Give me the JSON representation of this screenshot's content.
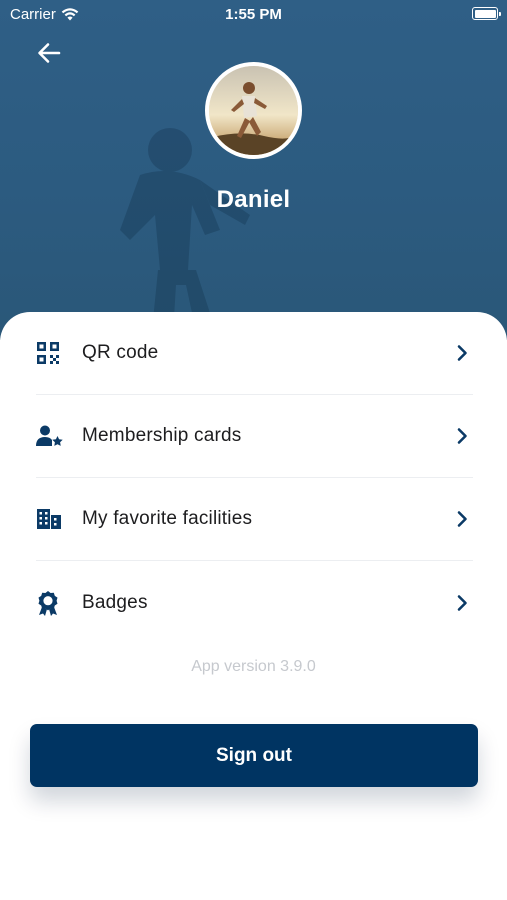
{
  "status_bar": {
    "carrier": "Carrier",
    "time": "1:55 PM"
  },
  "profile": {
    "name": "Daniel"
  },
  "menu": {
    "items": [
      {
        "label": "QR code",
        "icon": "qr-code-icon"
      },
      {
        "label": "Membership cards",
        "icon": "member-star-icon"
      },
      {
        "label": "My favorite facilities",
        "icon": "building-icon"
      },
      {
        "label": "Badges",
        "icon": "award-badge-icon"
      }
    ]
  },
  "footer": {
    "app_version": "App version 3.9.0",
    "sign_out_label": "Sign out"
  },
  "colors": {
    "primary": "#003462",
    "hero": "#2f5f86",
    "icon": "#0b3a66"
  }
}
